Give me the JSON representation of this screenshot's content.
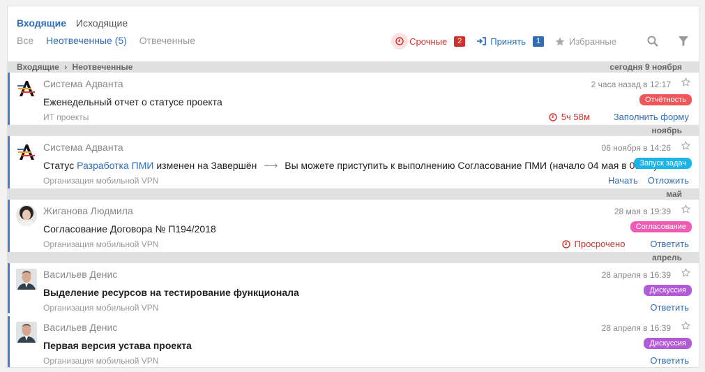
{
  "tabs": [
    {
      "label": "Входящие",
      "active": true
    },
    {
      "label": "Исходящие",
      "active": false
    }
  ],
  "subtabs": [
    {
      "label": "Все",
      "active": false
    },
    {
      "label": "Неотвеченные (5)",
      "active": true
    },
    {
      "label": "Отвеченные",
      "active": false
    }
  ],
  "filters": {
    "urgent": {
      "label": "Срочные",
      "count": "2",
      "color": "#d0312d"
    },
    "accept": {
      "label": "Принять",
      "count": "1",
      "color": "#2f6db7"
    },
    "favorites": {
      "label": "Избранные"
    }
  },
  "breadcrumb": {
    "root": "Входящие",
    "current": "Неотвеченные"
  },
  "groups": [
    "сегодня 9 ноября",
    "ноябрь",
    "май",
    "апрель"
  ],
  "messages": [
    {
      "sender": "Система Адванта",
      "time": "2 часа назад в 12:17",
      "subject": "Еженедельный отчет о статусе проекта",
      "org": "ИТ проекты",
      "tag": "Отчётность",
      "tag_color": "#f0565a",
      "timer": "5ч 58м",
      "action": "Заполнить форму"
    },
    {
      "sender": "Система Адванта",
      "time": "06 ноября в 14:26",
      "subject_prefix": "Статус",
      "subject_link": "Разработка ПМИ",
      "subject_mid": "изменен на Завершён",
      "subject_suffix": "Вы можете приступить к выполнению Согласование ПМИ (начало 04 мая в 09:02)",
      "org": "Организация мобильной VPN",
      "tag": "Запуск задач",
      "tag_color": "#1ab5e8",
      "action1": "Начать",
      "action2": "Отложить"
    },
    {
      "sender": "Жиганова Людмила",
      "time": "28 мая в 19:39",
      "subject": "Согласование Договора № П194/2018",
      "org": "Организация мобильной VPN",
      "tag": "Согласование",
      "tag_color": "#f05cb5",
      "warn": "Просрочено",
      "action": "Ответить"
    },
    {
      "sender": "Васильев Денис",
      "time": "28 апреля в 16:39",
      "subject": "Выделение ресурсов на тестирование функционала",
      "org": "Организация мобильной VPN",
      "tag": "Дискуссия",
      "tag_color": "#b25bd6",
      "action": "Ответить"
    },
    {
      "sender": "Васильев Денис",
      "time": "28 апреля в 16:39",
      "subject": "Первая версия устава проекта",
      "org": "Организация мобильной VPN",
      "tag": "Дискуссия",
      "tag_color": "#b25bd6",
      "action": "Ответить"
    }
  ]
}
